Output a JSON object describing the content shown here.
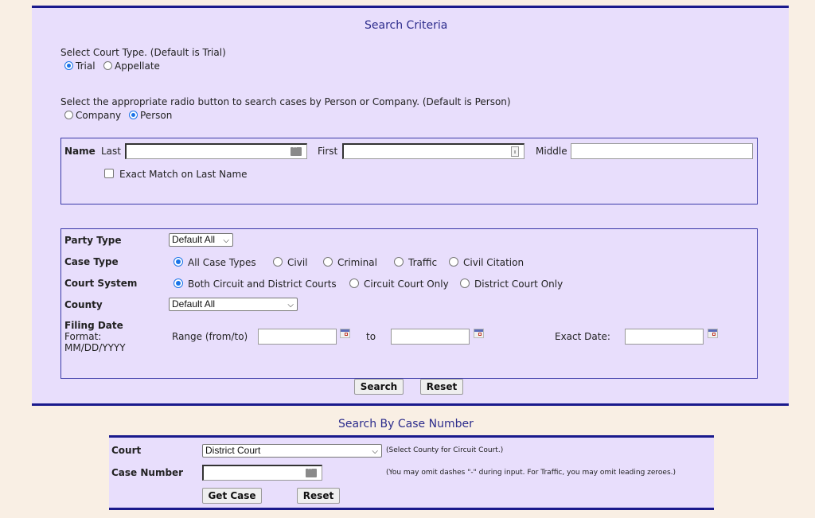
{
  "search_criteria": {
    "title": "Search Criteria",
    "court_type": {
      "prompt": "Select Court Type. (Default is Trial)",
      "options": [
        {
          "label": "Trial",
          "selected": true
        },
        {
          "label": "Appellate",
          "selected": false
        }
      ]
    },
    "entity_type": {
      "prompt": "Select the appropriate radio button to search cases by Person or Company. (Default is Person)",
      "options": [
        {
          "label": "Company",
          "selected": false
        },
        {
          "label": "Person",
          "selected": true
        }
      ]
    },
    "name": {
      "label": "Name",
      "last_label": "Last",
      "last_value": "",
      "first_label": "First",
      "first_value": "",
      "middle_label": "Middle",
      "middle_value": "",
      "exact_match_label": "Exact Match on Last Name",
      "exact_match_checked": false
    },
    "filters": {
      "party_type": {
        "label": "Party Type",
        "selected": "Default All"
      },
      "case_type": {
        "label": "Case Type",
        "options": [
          {
            "label": "All Case Types",
            "selected": true
          },
          {
            "label": "Civil",
            "selected": false
          },
          {
            "label": "Criminal",
            "selected": false
          },
          {
            "label": "Traffic",
            "selected": false
          },
          {
            "label": "Civil Citation",
            "selected": false
          }
        ]
      },
      "court_system": {
        "label": "Court System",
        "options": [
          {
            "label": "Both Circuit and District Courts",
            "selected": true
          },
          {
            "label": "Circuit Court Only",
            "selected": false
          },
          {
            "label": "District Court Only",
            "selected": false
          }
        ]
      },
      "county": {
        "label": "County",
        "selected": "Default All"
      },
      "filing_date": {
        "label": "Filing Date",
        "format_label": "Format:",
        "format_value": "MM/DD/YYYY",
        "range_label": "Range (from/to)",
        "from_value": "",
        "to_label": "to",
        "to_value": "",
        "exact_label": "Exact Date:",
        "exact_value": ""
      }
    },
    "buttons": {
      "search": "Search",
      "reset": "Reset"
    }
  },
  "case_number_search": {
    "title": "Search By Case Number",
    "court_label": "Court",
    "court_selected": "District Court",
    "court_hint": "(Select County for Circuit Court.)",
    "case_number_label": "Case Number",
    "case_number_value": "",
    "case_number_hint": "(You may omit dashes \"-\" during input. For Traffic, you may omit leading zeroes.)",
    "buttons": {
      "get_case": "Get Case",
      "reset": "Reset"
    }
  }
}
